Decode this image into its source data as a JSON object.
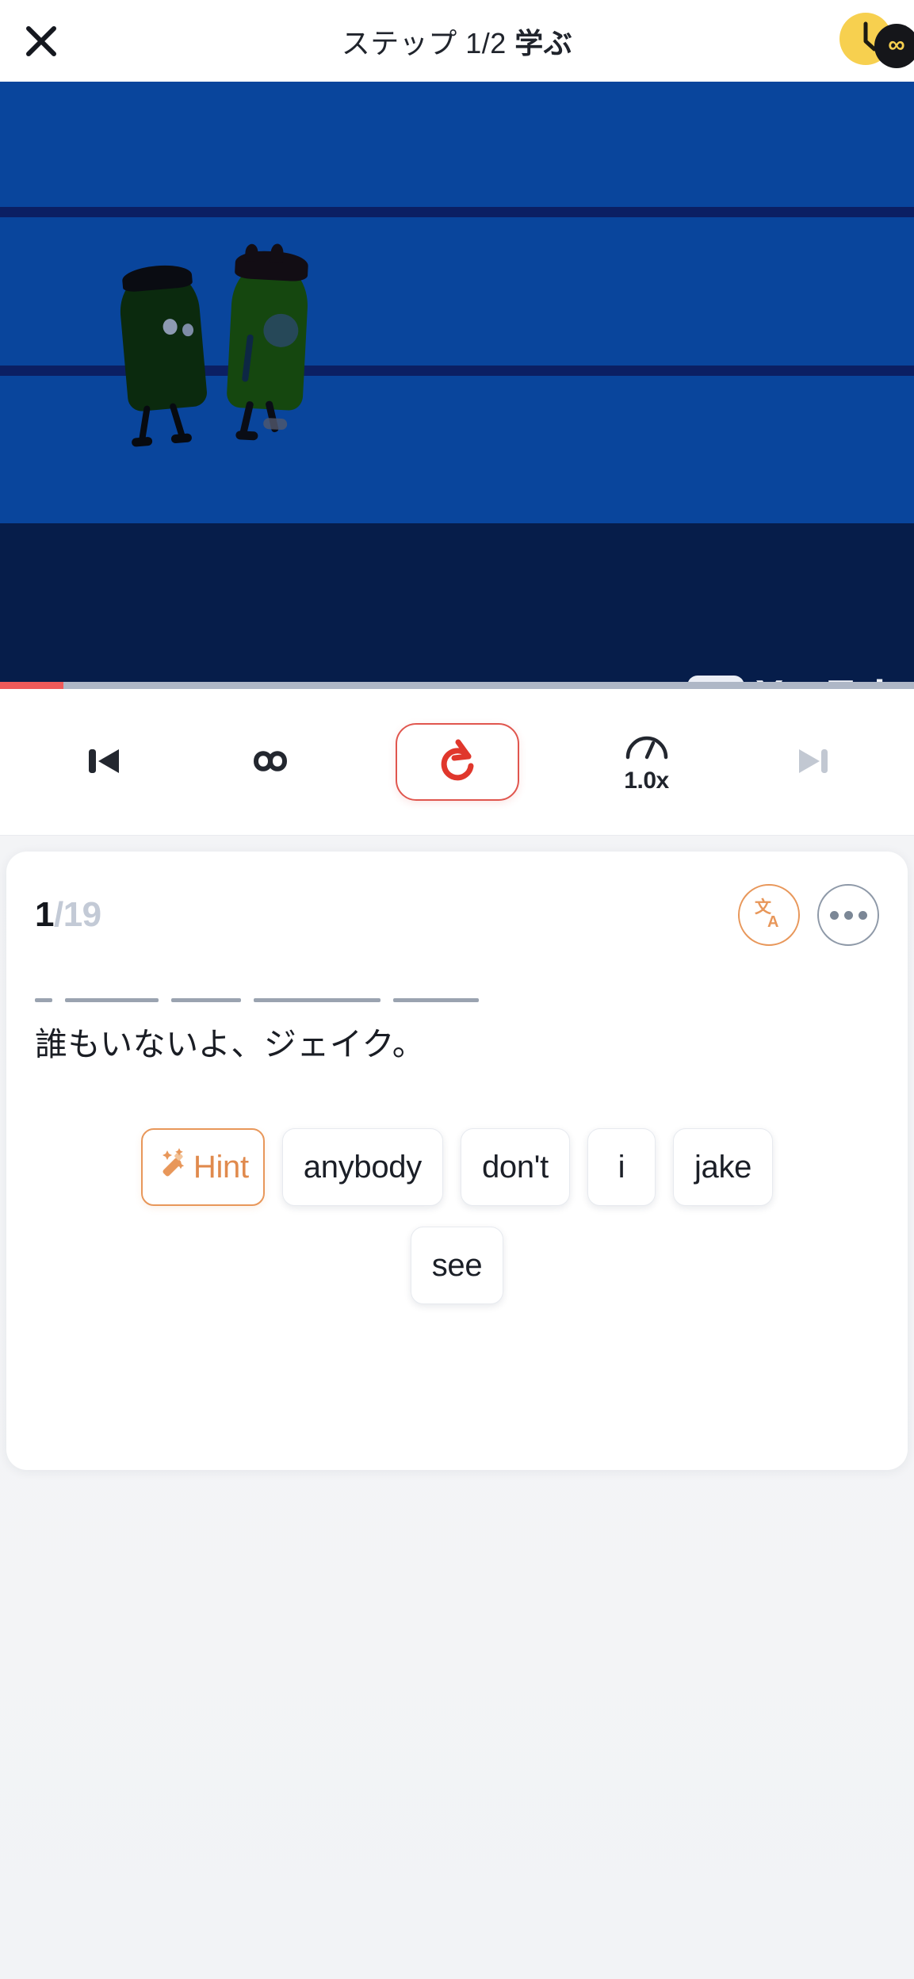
{
  "header": {
    "close_icon": "close-icon",
    "title_prefix": "ステップ 1/2 ",
    "title_bold": "学ぶ",
    "streak": {
      "clock_icon": "clock-icon",
      "infinity_symbol": "∞"
    }
  },
  "video": {
    "watermark": "YouTube",
    "play_icon": "youtube-play-icon",
    "progress_percent": 7
  },
  "controls": {
    "previous_icon": "skip-previous-icon",
    "loop_icon": "infinity-loop-icon",
    "replay_icon": "replay-icon",
    "speed_icon": "speedometer-icon",
    "speed_label": "1.0x",
    "next_icon": "skip-next-icon"
  },
  "card": {
    "current_index": "1",
    "total_index": "/19",
    "translate_icon": "translate-icon",
    "more_icon": "more-options-icon",
    "blanks": [
      22,
      118,
      88,
      160,
      108
    ],
    "sentence_translation": "誰もいないよ、ジェイク。",
    "hint": {
      "icon": "magic-wand-icon",
      "label": "Hint"
    },
    "choices_row1": [
      "anybody",
      "don't",
      "i",
      "jake"
    ],
    "choices_row2": [
      "see"
    ]
  },
  "colors": {
    "accent_orange": "#e8975a",
    "accent_red": "#e0564e",
    "progress_red": "#ef5a5a",
    "streak_yellow": "#f7d04f",
    "text_dark": "#1b1f27",
    "muted": "#c3cad6"
  }
}
